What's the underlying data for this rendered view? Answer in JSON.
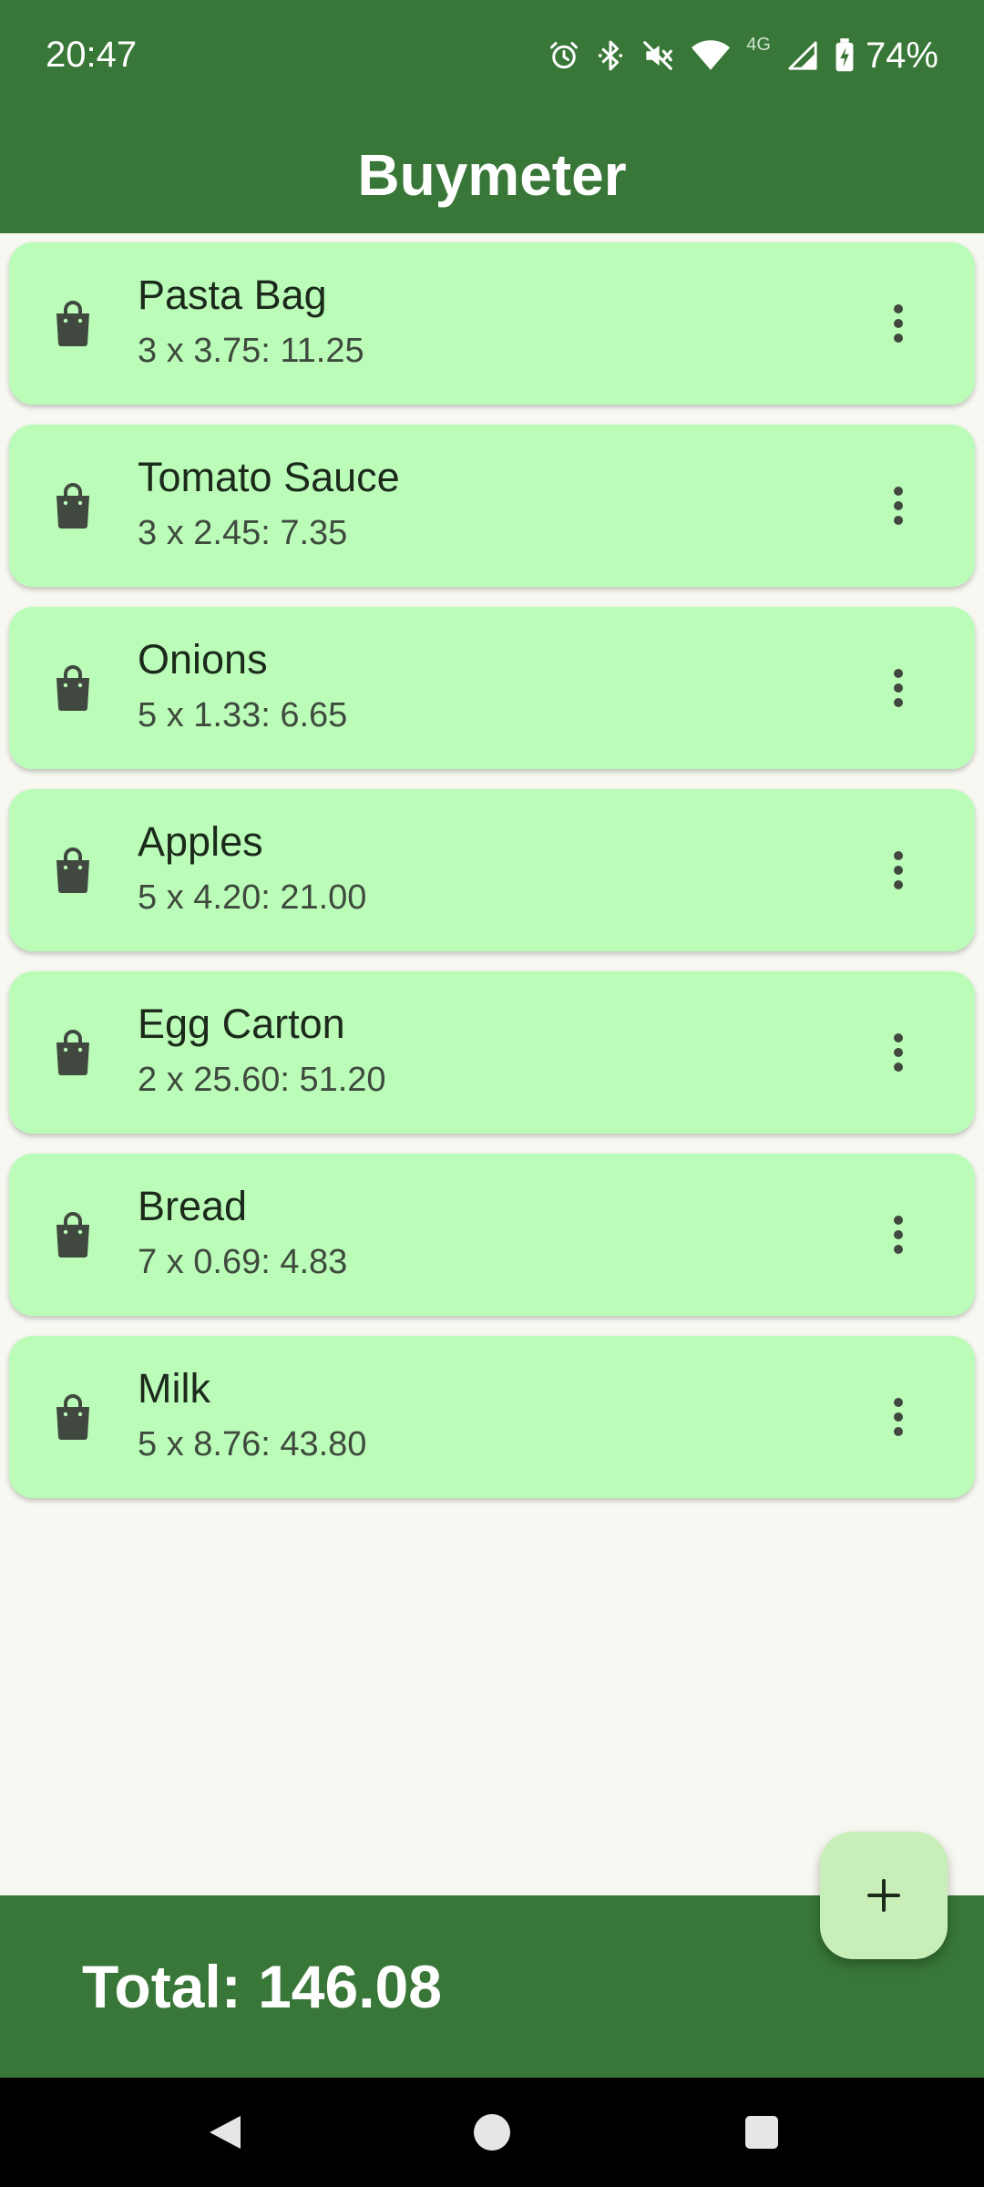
{
  "status_bar": {
    "time": "20:47",
    "icons": [
      "alarm-icon",
      "bluetooth-icon",
      "mute-icon",
      "wifi-icon",
      "4g-icon",
      "signal-icon",
      "battery-charging-icon"
    ],
    "network_label": "4G",
    "battery": "74%"
  },
  "app_bar": {
    "title": "Buymeter"
  },
  "items": [
    {
      "name": "Pasta Bag",
      "detail": "3 x 3.75: 11.25"
    },
    {
      "name": "Tomato Sauce",
      "detail": "3 x 2.45: 7.35"
    },
    {
      "name": "Onions",
      "detail": "5 x 1.33: 6.65"
    },
    {
      "name": "Apples",
      "detail": "5 x 4.20: 21.00"
    },
    {
      "name": "Egg Carton",
      "detail": "2 x 25.60: 51.20"
    },
    {
      "name": "Bread",
      "detail": "7 x 0.69: 4.83"
    },
    {
      "name": "Milk",
      "detail": "5 x 8.76: 43.80"
    }
  ],
  "footer": {
    "total": "Total: 146.08"
  },
  "fab": {
    "icon": "plus-icon"
  },
  "nav_bar": {
    "icons": [
      "back-icon",
      "home-icon",
      "recents-icon"
    ]
  },
  "colors": {
    "primary": "#387737",
    "card": "#bbfdb8",
    "fab": "#c9efb8",
    "background": "#f7f8f1"
  }
}
